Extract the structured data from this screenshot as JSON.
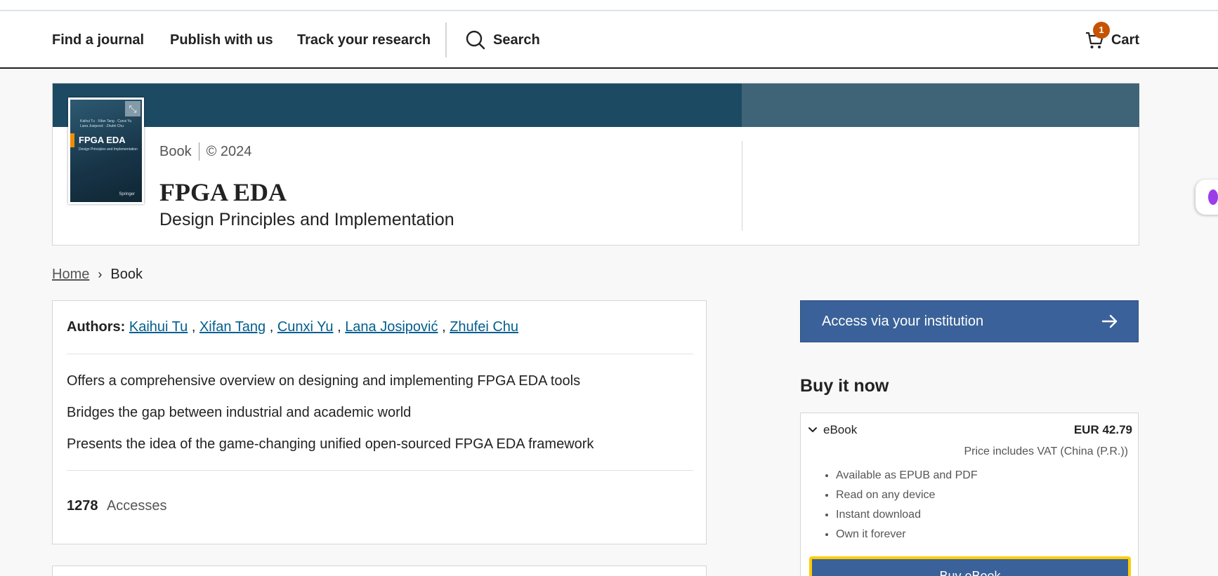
{
  "nav": {
    "find_journal": "Find a journal",
    "publish": "Publish with us",
    "track": "Track your research",
    "search": "Search",
    "cart": "Cart",
    "cart_count": "1"
  },
  "book": {
    "type": "Book",
    "year": "© 2024",
    "title": "FPGA EDA",
    "subtitle": "Design Principles and Implementation",
    "cover": {
      "authors_line1": "Kaihui Tu · Xifan Tang · Cunxi Yu",
      "authors_line2": "Lana Josipović · Zhufei Chu",
      "title": "FPGA EDA",
      "subtitle": "Design Principles and Implementation",
      "publisher": "Springer"
    }
  },
  "breadcrumb": {
    "home": "Home",
    "current": "Book"
  },
  "authors": {
    "label": "Authors:",
    "names": [
      "Kaihui Tu",
      "Xifan Tang",
      "Cunxi Yu",
      "Lana Josipović",
      "Zhufei Chu"
    ],
    "separator": ","
  },
  "highlights": [
    "Offers a comprehensive overview on designing and implementing FPGA EDA tools",
    "Bridges the gap between industrial and academic world",
    "Presents the idea of the game-changing unified open-sourced FPGA EDA framework"
  ],
  "metrics": {
    "accesses_count": "1278",
    "accesses_label": "Accesses"
  },
  "purchase": {
    "access_label": "Access via your institution",
    "heading": "Buy it now",
    "ebook_label": "eBook",
    "price": "EUR 42.79",
    "vat_note": "Price includes VAT (China (P.R.))",
    "features": [
      "Available as EPUB and PDF",
      "Read on any device",
      "Instant download",
      "Own it forever"
    ],
    "buy_label": "Buy eBook"
  },
  "colors": {
    "brand_blue": "#3a6199",
    "hero_band": "#1d4a63",
    "link": "#025e8d",
    "badge": "#c65301",
    "focus": "#ffcc00"
  }
}
